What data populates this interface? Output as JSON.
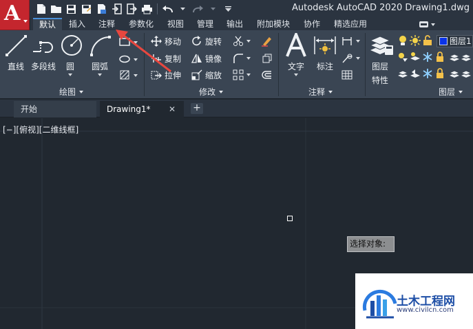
{
  "window": {
    "title": "Autodesk AutoCAD 2020    Drawing1.dwg"
  },
  "app_button": {
    "letter": "A"
  },
  "quick_access": [
    "new-icon",
    "open-icon",
    "save-icon",
    "save-as-icon",
    "publish-icon",
    "import-icon",
    "export-icon",
    "print-icon",
    "undo-icon",
    "redo-icon",
    "customize-icon"
  ],
  "tabs": [
    {
      "label": "默认",
      "active": true
    },
    {
      "label": "插入"
    },
    {
      "label": "注释"
    },
    {
      "label": "参数化"
    },
    {
      "label": "视图"
    },
    {
      "label": "管理"
    },
    {
      "label": "输出"
    },
    {
      "label": "附加模块"
    },
    {
      "label": "协作"
    },
    {
      "label": "精选应用"
    }
  ],
  "panels": {
    "draw": {
      "title": "绘图",
      "tools": {
        "line": "直线",
        "polyline": "多段线",
        "circle": "圆",
        "arc": "圆弧"
      }
    },
    "modify": {
      "title": "修改",
      "tools": {
        "move": "移动",
        "rotate": "旋转",
        "copy": "复制",
        "mirror": "镜像",
        "stretch": "拉伸",
        "scale": "缩放"
      }
    },
    "annotation": {
      "title": "注释",
      "tools": {
        "text": "文字",
        "dimension": "标注"
      }
    },
    "layers": {
      "title": "图层",
      "tools": {
        "layer_properties_l1": "图层",
        "layer_properties_l2": "特性"
      },
      "current_layer": "图层1",
      "current_color": "#0a33e8"
    }
  },
  "file_tabs": [
    {
      "label": "开始"
    },
    {
      "label": "Drawing1*",
      "active": true
    }
  ],
  "canvas": {
    "viewport_label": "[−][俯视][二维线框]",
    "prompt": "选择对象:"
  },
  "watermark": {
    "name": "土木工程网",
    "url": "www.civilcn.com"
  },
  "colors": {
    "accent": "#c4262e",
    "arrow": "#e8473f",
    "background": "#212830",
    "ribbon": "#3a4553"
  }
}
